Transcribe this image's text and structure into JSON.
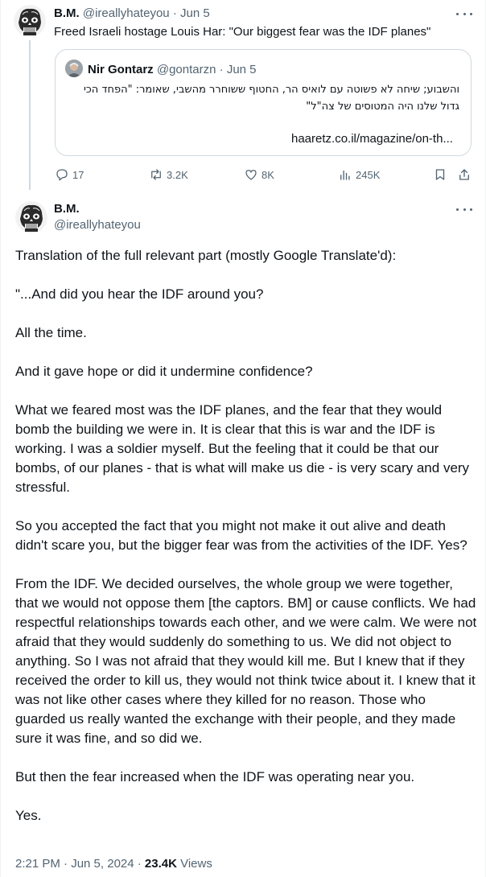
{
  "thread": {
    "tweet1": {
      "author_name": "B.M.",
      "author_handle": "@ireallyhateyou",
      "separator": "·",
      "date": "Jun 5",
      "text": "Freed Israeli hostage Louis Har: \"Our biggest fear was the IDF planes\"",
      "more_icon": "more-dots-icon",
      "quote": {
        "author_name": "Nir Gontarz",
        "author_handle": "@gontarzn",
        "separator": "·",
        "date": "Jun 5",
        "text_line1": "והשבוע; שיחה לא פשוטה עם לואיס הר, החטוף ששוחרר מהשבי, שאומר: \"הפחד הכי",
        "text_line2": "גדול שלנו היה המטוסים של צה\"ל\"",
        "link": "haaretz.co.il/magazine/on-th..."
      },
      "actions": {
        "reply_count": "17",
        "repost_count": "3.2K",
        "like_count": "8K",
        "views_count": "245K"
      }
    },
    "tweet2": {
      "author_name": "B.M.",
      "author_handle": "@ireallyhateyou",
      "more_icon": "more-dots-icon",
      "paragraphs": [
        "Translation of the full relevant part (mostly Google Translate'd):",
        "\"...And did you hear the IDF around you?",
        "All the time.",
        "And it gave hope or did it undermine confidence?",
        "What we feared most was the IDF planes, and the fear that they would bomb the building we were in. It is clear that this is war and the IDF is working. I was a soldier myself. But the feeling that it could be that our bombs, of our planes - that is what will make us die - is very scary and very stressful.",
        "So you accepted the fact that you might not make it out alive and death didn't scare you, but the bigger fear was from the activities of the IDF. Yes?",
        "From the IDF. We decided ourselves, the whole group we were together, that we would not oppose them [the captors. BM] or cause conflicts. We had respectful relationships towards each other, and we were calm. We were not afraid that they would suddenly do something to us. We did not object to anything. So I was not afraid that they would kill me. But I knew that if they received the order to kill us, they would not think twice about it. I knew that it was not like other cases where they killed for no reason. Those who guarded us really wanted the exchange with their people, and they made sure it was fine, and so did we.",
        "But then the fear increased when the IDF was operating near you.",
        "Yes."
      ],
      "timestamp": "2:21 PM · Jun 5, 2024 · ",
      "views_count": "23.4K",
      "views_label": " Views"
    }
  },
  "colors": {
    "text": "#0f1419",
    "secondary": "#536471",
    "border": "#cfd9de"
  }
}
